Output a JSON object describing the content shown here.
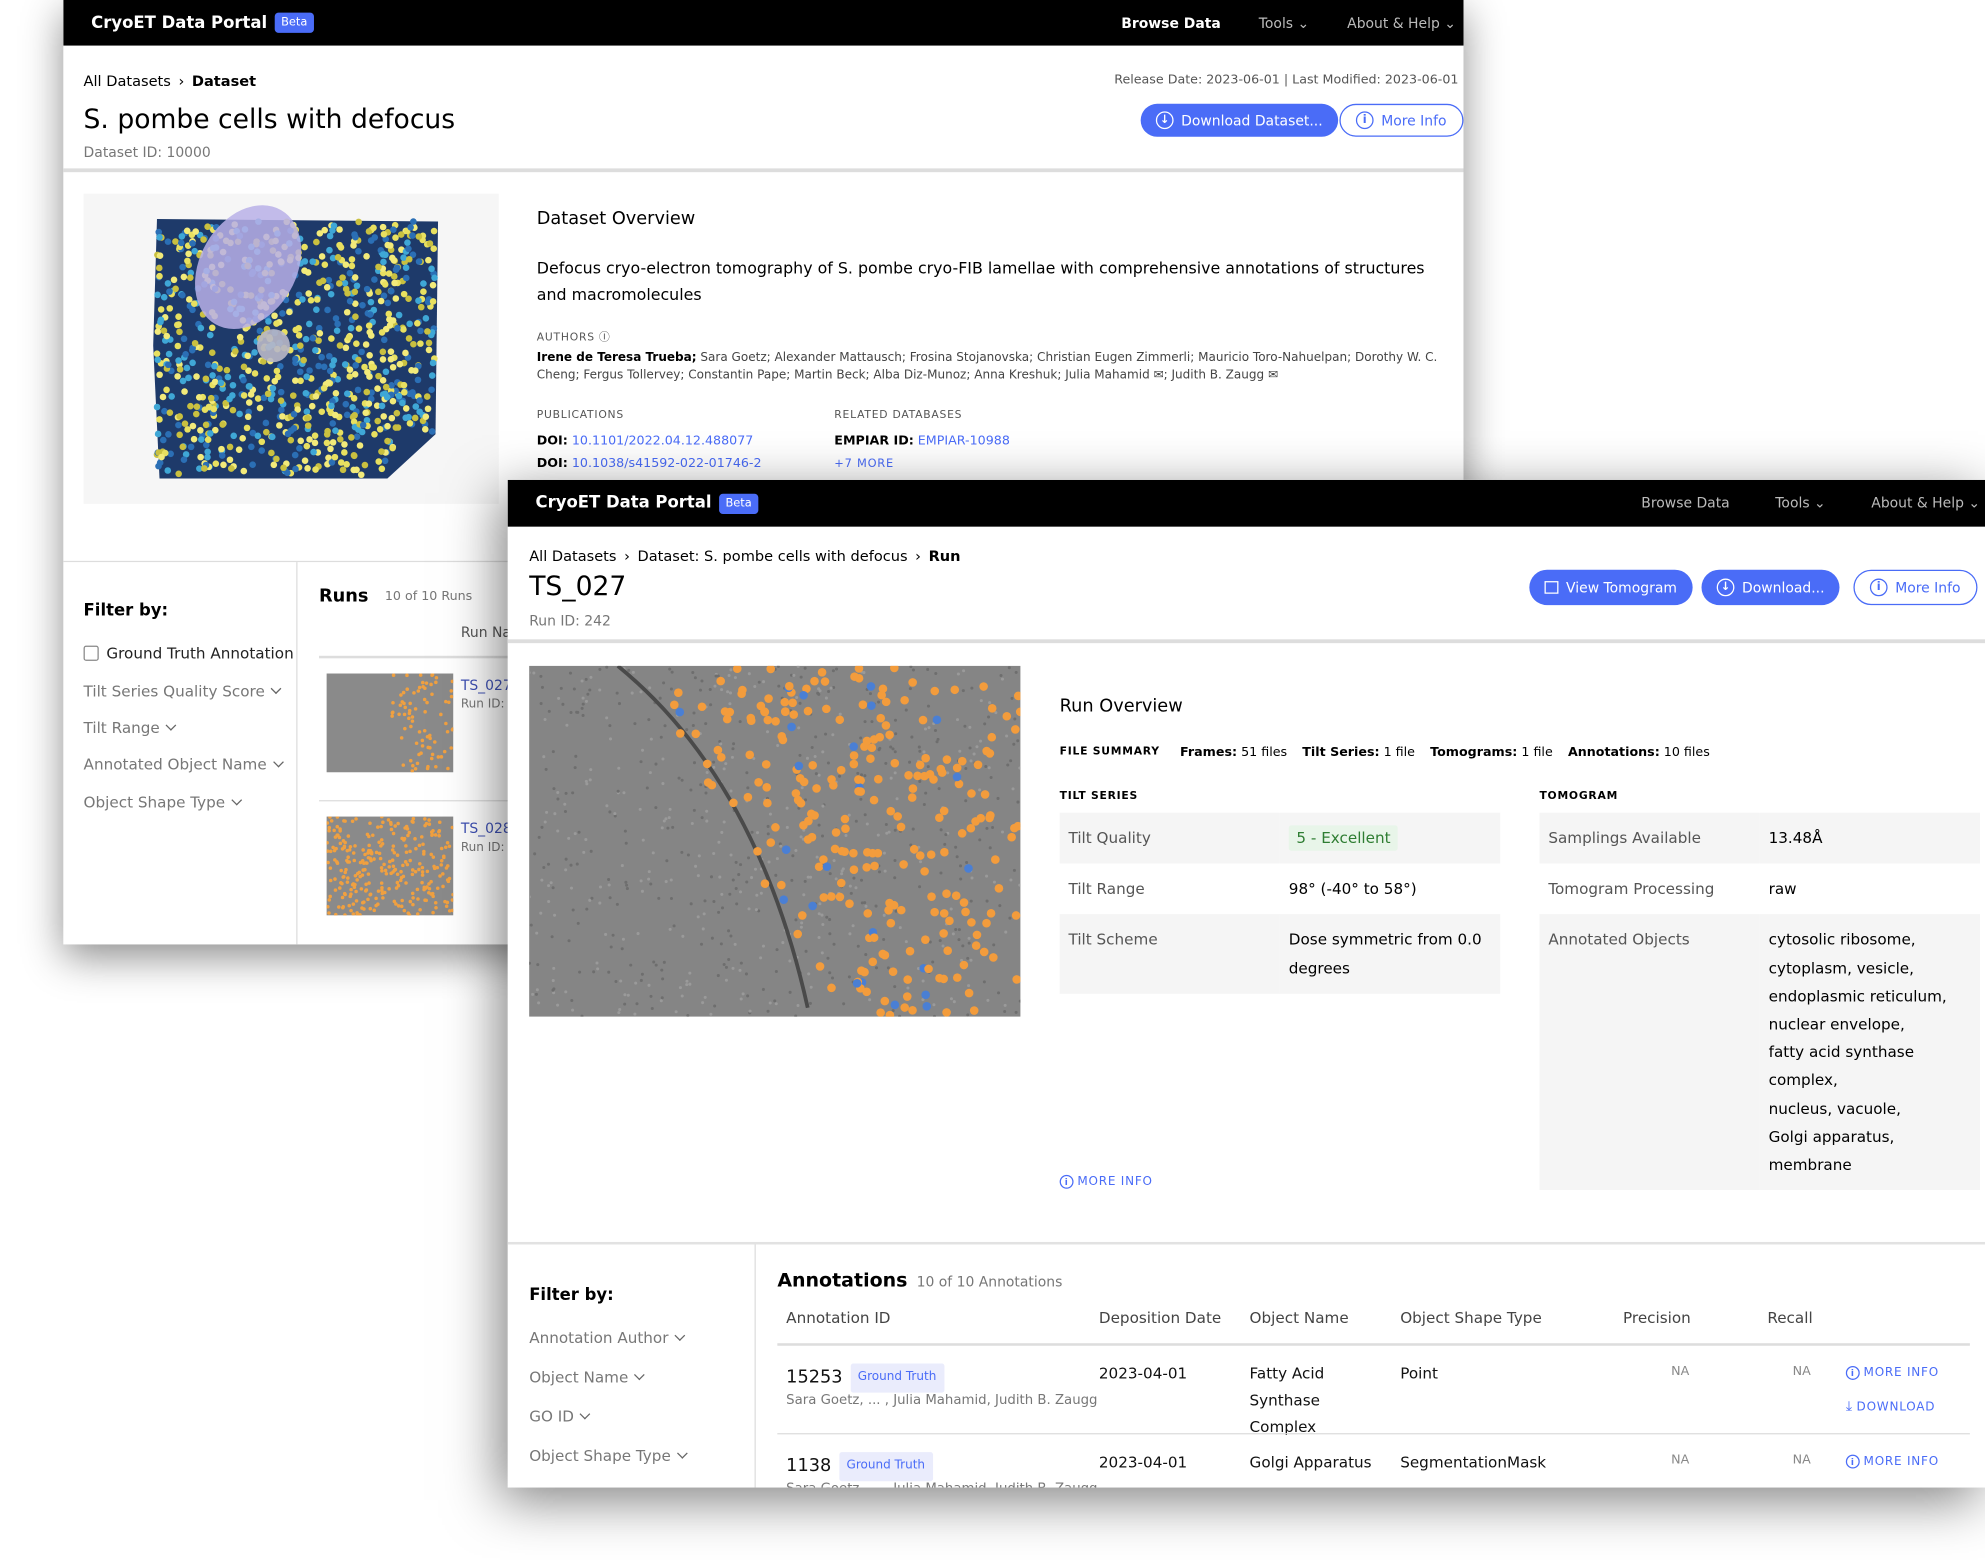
{
  "colors": {
    "accent": "#4a6cf7",
    "nav": "#000000",
    "excellent": "#2e7d32",
    "annotation_dot": "#f39c3c"
  },
  "nav": {
    "brand": "CryoET Data Portal",
    "beta": "Beta",
    "browse": "Browse Data",
    "tools": "Tools",
    "about": "About & Help"
  },
  "dataset": {
    "breadcrumb": [
      "All Datasets",
      "Dataset"
    ],
    "dates": "Release Date: 2023-06-01 | Last Modified: 2023-06-01",
    "title": "S. pombe cells with defocus",
    "id": "Dataset ID: 10000",
    "download": "Download Dataset...",
    "more_info": "More Info",
    "overview_title": "Dataset Overview",
    "description": "Defocus cryo-electron tomography of S. pombe cryo-FIB lamellae with comprehensive annotations of structures and macromolecules",
    "authors_label": "AUTHORS",
    "authors_primary": "Irene de Teresa Trueba;",
    "authors_rest": " Sara Goetz; Alexander Mattausch; Frosina Stojanovska; Christian Eugen Zimmerli; Mauricio Toro-Nahuelpan; Dorothy W. C. Cheng; Fergus Tollervey; Constantin Pape; Martin Beck; Alba Diz-Munoz; Anna Kreshuk; Julia Mahamid ✉; Judith B. Zaugg ✉",
    "publications_label": "PUBLICATIONS",
    "publications": [
      {
        "k": "DOI:",
        "v": "10.1101/2022.04.12.488077"
      },
      {
        "k": "DOI:",
        "v": "10.1038/s41592-022-01746-2"
      }
    ],
    "related_label": "RELATED DATABASES",
    "empiar_k": "EMPIAR ID:",
    "empiar_v": "EMPIAR-10988",
    "more": "+7 MORE",
    "filter_title": "Filter by:",
    "filters": [
      "Ground Truth Annotation",
      "Tilt Series Quality Score",
      "Tilt Range",
      "Annotated Object Name",
      "Object Shape Type"
    ],
    "runs_title": "Runs",
    "runs_count": "10 of 10 Runs",
    "run_col": "Run Na",
    "runs": [
      {
        "name": "TS_027",
        "id": "Run ID:"
      },
      {
        "name": "TS_028",
        "id": "Run ID:"
      }
    ]
  },
  "run": {
    "breadcrumb": [
      "All Datasets",
      "Dataset: S. pombe cells with defocus",
      "Run"
    ],
    "title": "TS_027",
    "id": "Run ID: 242",
    "view": "View Tomogram",
    "download": "Download...",
    "more_info": "More Info",
    "overview_title": "Run Overview",
    "file_summary_label": "FILE SUMMARY",
    "file_summary": [
      {
        "k": "Frames:",
        "v": "51 files"
      },
      {
        "k": "Tilt Series:",
        "v": "1 file"
      },
      {
        "k": "Tomograms:",
        "v": "1 file"
      },
      {
        "k": "Annotations:",
        "v": "10 files"
      }
    ],
    "tilt_label": "TILT SERIES",
    "tilt": [
      {
        "k": "Tilt Quality",
        "v": "5 - Excellent"
      },
      {
        "k": "Tilt Range",
        "v": "98° (-40° to 58°)"
      },
      {
        "k": "Tilt Scheme",
        "v": "Dose symmetric from 0.0 degrees"
      }
    ],
    "tomo_label": "TOMOGRAM",
    "tomo": [
      {
        "k": "Samplings Available",
        "v": "13.48Å"
      },
      {
        "k": "Tomogram Processing",
        "v": "raw"
      },
      {
        "k": "Annotated Objects",
        "v": [
          "cytosolic ribosome,",
          "cytoplasm, vesicle,",
          "endoplasmic reticulum,",
          "nuclear envelope,",
          "fatty acid synthase complex,",
          "nucleus, vacuole,",
          "Golgi apparatus, membrane"
        ]
      }
    ],
    "more_info_link": "MORE INFO",
    "filter_title": "Filter by:",
    "filters": [
      "Annotation Author",
      "Object Name",
      "GO ID",
      "Object Shape Type"
    ],
    "ann_title": "Annotations",
    "ann_count": "10 of 10 Annotations",
    "columns": [
      "Annotation ID",
      "Deposition Date",
      "Object Name",
      "Object Shape Type",
      "Precision",
      "Recall"
    ],
    "rows": [
      {
        "id": "15253",
        "badge": "Ground Truth",
        "authors": "Sara Goetz, ... , Julia Mahamid, Judith B. Zaugg",
        "date": "2023-04-01",
        "object": "Fatty Acid Synthase Complex",
        "shape": "Point",
        "precision": "NA",
        "recall": "NA",
        "more": "MORE INFO",
        "download": "DOWNLOAD"
      },
      {
        "id": "1138",
        "badge": "Ground Truth",
        "authors": "Sara Goetz, ... , Julia Mahamid, Judith B. Zaugg",
        "date": "2023-04-01",
        "object": "Golgi Apparatus",
        "shape": "SegmentationMask",
        "precision": "NA",
        "recall": "NA",
        "more": "MORE INFO"
      }
    ]
  }
}
